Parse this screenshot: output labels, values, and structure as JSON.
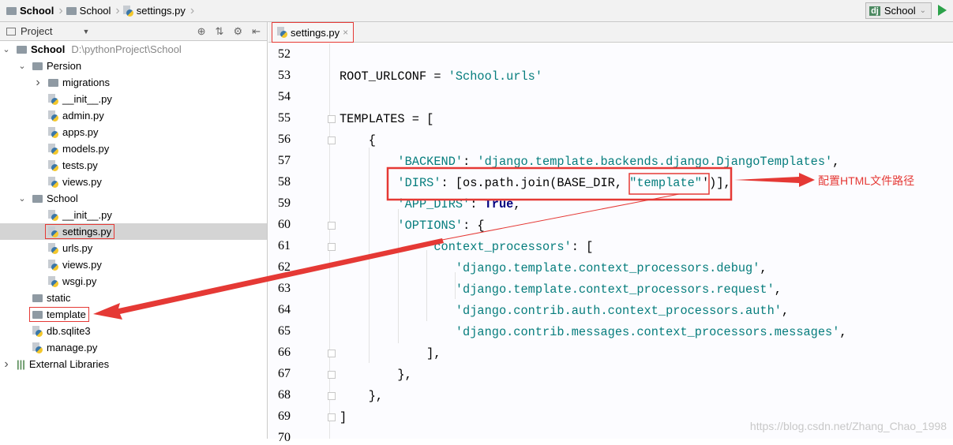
{
  "breadcrumb": [
    {
      "label": "School",
      "bold": true,
      "icon": "folder-icon"
    },
    {
      "label": "School",
      "icon": "folder-icon"
    },
    {
      "label": "settings.py",
      "icon": "python-file-icon"
    }
  ],
  "run_config": {
    "badge": "dj",
    "label": "School"
  },
  "project_panel": {
    "title": "Project"
  },
  "tree": [
    {
      "label": "School",
      "extra": "D:\\pythonProject\\School",
      "level": 0,
      "chev": "down",
      "icon": "folder",
      "bold": true
    },
    {
      "label": "Persion",
      "level": 1,
      "chev": "down",
      "icon": "folder"
    },
    {
      "label": "migrations",
      "level": 2,
      "chev": "right",
      "icon": "folder"
    },
    {
      "label": "__init__.py",
      "level": 2,
      "icon": "py"
    },
    {
      "label": "admin.py",
      "level": 2,
      "icon": "py"
    },
    {
      "label": "apps.py",
      "level": 2,
      "icon": "py"
    },
    {
      "label": "models.py",
      "level": 2,
      "icon": "py"
    },
    {
      "label": "tests.py",
      "level": 2,
      "icon": "py"
    },
    {
      "label": "views.py",
      "level": 2,
      "icon": "py"
    },
    {
      "label": "School",
      "level": 1,
      "chev": "down",
      "icon": "folder"
    },
    {
      "label": "__init__.py",
      "level": 2,
      "icon": "py"
    },
    {
      "label": "settings.py",
      "level": 2,
      "icon": "py",
      "selected": true,
      "boxed": true
    },
    {
      "label": "urls.py",
      "level": 2,
      "icon": "py"
    },
    {
      "label": "views.py",
      "level": 2,
      "icon": "py"
    },
    {
      "label": "wsgi.py",
      "level": 2,
      "icon": "py"
    },
    {
      "label": "static",
      "level": 1,
      "icon": "folder"
    },
    {
      "label": "template",
      "level": 1,
      "icon": "folder",
      "boxed": true
    },
    {
      "label": "db.sqlite3",
      "level": 1,
      "icon": "file"
    },
    {
      "label": "manage.py",
      "level": 1,
      "icon": "py"
    },
    {
      "label": "External Libraries",
      "level": 0,
      "chev": "right",
      "icon": "lib"
    }
  ],
  "editor_tab": {
    "label": "settings.py",
    "close": "×"
  },
  "code": [
    {
      "n": "52",
      "t": []
    },
    {
      "n": "53",
      "t": [
        [
          "",
          "ROOT_URLCONF = "
        ],
        [
          "s",
          "'School.urls'"
        ]
      ]
    },
    {
      "n": "54",
      "t": []
    },
    {
      "n": "55",
      "t": [
        [
          "",
          "TEMPLATES = ["
        ]
      ]
    },
    {
      "n": "56",
      "t": [
        [
          "",
          "    {"
        ]
      ]
    },
    {
      "n": "57",
      "t": [
        [
          "s",
          "        'BACKEND'"
        ],
        [
          "",
          ": "
        ],
        [
          "s",
          "'django.template.backends.django.DjangoTemplates'"
        ],
        [
          "",
          ","
        ]
      ]
    },
    {
      "n": "58",
      "t": [
        [
          "s",
          "        'DIRS'"
        ],
        [
          "",
          ": [os.path.join(BASE_DIR, "
        ],
        [
          "s",
          "\"template\""
        ],
        [
          "",
          "')],"
        ]
      ]
    },
    {
      "n": "59",
      "t": [
        [
          "s",
          "        'APP_DIRS'"
        ],
        [
          "",
          ": "
        ],
        [
          "kw",
          "True"
        ],
        [
          "",
          ","
        ]
      ]
    },
    {
      "n": "60",
      "t": [
        [
          "s",
          "        'OPTIONS'"
        ],
        [
          "",
          ": {"
        ]
      ]
    },
    {
      "n": "61",
      "t": [
        [
          "s",
          "            'context_processors'"
        ],
        [
          "",
          ": ["
        ]
      ]
    },
    {
      "n": "62",
      "t": [
        [
          "s",
          "                'django.template.context_processors.debug'"
        ],
        [
          "",
          ","
        ]
      ]
    },
    {
      "n": "63",
      "t": [
        [
          "s",
          "                'django.template.context_processors.request'"
        ],
        [
          "",
          ","
        ]
      ]
    },
    {
      "n": "64",
      "t": [
        [
          "s",
          "                'django.contrib.auth.context_processors.auth'"
        ],
        [
          "",
          ","
        ]
      ]
    },
    {
      "n": "65",
      "t": [
        [
          "s",
          "                'django.contrib.messages.context_processors.messages'"
        ],
        [
          "",
          ","
        ]
      ]
    },
    {
      "n": "66",
      "t": [
        [
          "",
          "            ],"
        ]
      ]
    },
    {
      "n": "67",
      "t": [
        [
          "",
          "        },"
        ]
      ]
    },
    {
      "n": "68",
      "t": [
        [
          "",
          "    },"
        ]
      ]
    },
    {
      "n": "69",
      "t": [
        [
          "",
          "]"
        ]
      ]
    },
    {
      "n": "70",
      "t": []
    }
  ],
  "annotation": "配置HTML文件路径",
  "watermark": "https://blog.csdn.net/Zhang_Chao_1998",
  "colors": {
    "annotation": "#e53935",
    "string": "#067d7d",
    "selection": "#d4d4d4"
  }
}
